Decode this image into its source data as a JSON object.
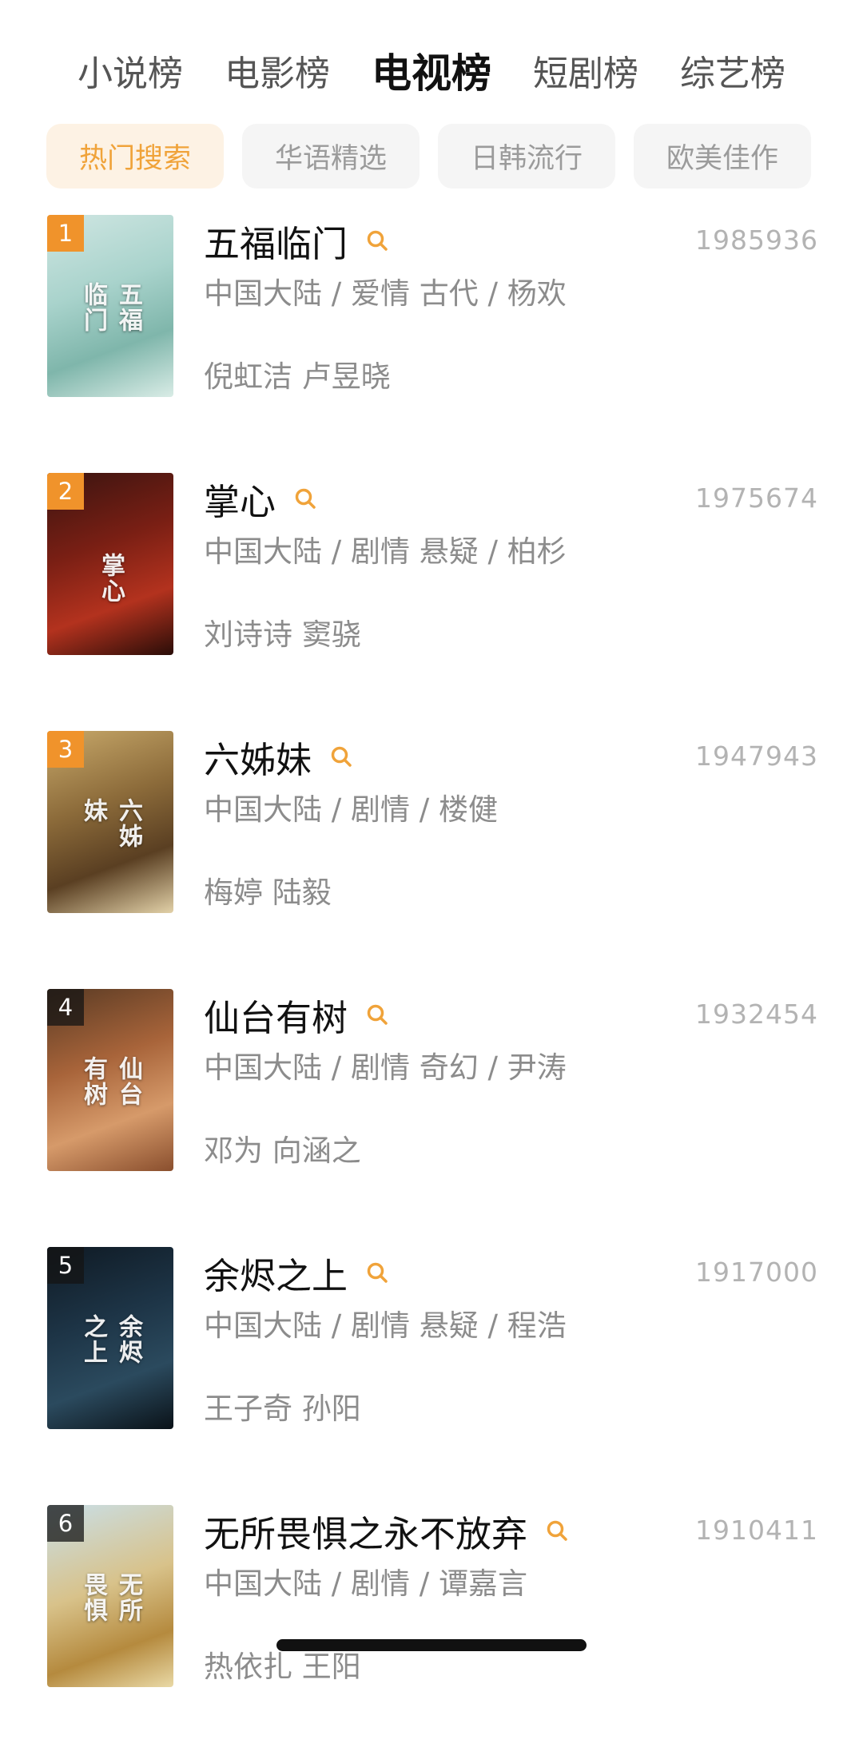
{
  "top_tabs": [
    "小说榜",
    "电影榜",
    "电视榜",
    "短剧榜",
    "综艺榜"
  ],
  "active_top_tab": "电视榜",
  "chips": [
    "热门搜索",
    "华语精选",
    "日韩流行",
    "欧美佳作"
  ],
  "active_chip": "热门搜索",
  "colors": {
    "accent": "#f0a33a",
    "rank_badge": "#f0932b",
    "chip_active_bg": "#fdf2e4"
  },
  "items": [
    {
      "rank": "1",
      "title": "五福临门",
      "score": "1985936",
      "meta": "中国大陆 / 爱情 古代 / 杨欢",
      "cast": "倪虹洁 卢昱晓",
      "poster_text": "五福临门"
    },
    {
      "rank": "2",
      "title": "掌心",
      "score": "1975674",
      "meta": "中国大陆 / 剧情 悬疑 / 柏杉",
      "cast": "刘诗诗 窦骁",
      "poster_text": "掌心"
    },
    {
      "rank": "3",
      "title": "六姊妹",
      "score": "1947943",
      "meta": "中国大陆 / 剧情 / 楼健",
      "cast": "梅婷 陆毅",
      "poster_text": "六姊妹"
    },
    {
      "rank": "4",
      "title": "仙台有树",
      "score": "1932454",
      "meta": "中国大陆 / 剧情 奇幻 / 尹涛",
      "cast": "邓为 向涵之",
      "poster_text": "仙台有树"
    },
    {
      "rank": "5",
      "title": "余烬之上",
      "score": "1917000",
      "meta": "中国大陆 / 剧情 悬疑 / 程浩",
      "cast": "王子奇 孙阳",
      "poster_text": "余烬之上"
    },
    {
      "rank": "6",
      "title": "无所畏惧之永不放弃",
      "score": "1910411",
      "meta": "中国大陆 / 剧情 / 谭嘉言",
      "cast": "热依扎 王阳",
      "poster_text": "无所畏惧"
    }
  ]
}
